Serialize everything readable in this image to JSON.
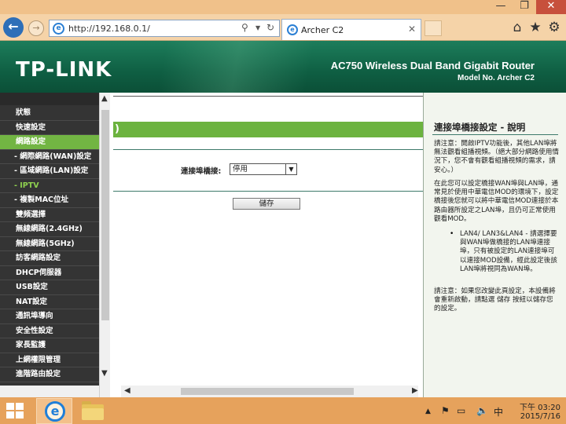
{
  "window": {
    "minimize_glyph": "—",
    "maximize_glyph": "❐",
    "close_glyph": "✕"
  },
  "browser": {
    "address": "http://192.168.0.1/",
    "tab_title": "Archer C2",
    "back_glyph": "←",
    "forward_glyph": "→",
    "search_glyph": "⚲",
    "dropdown_glyph": "▼",
    "refresh_glyph": "↻",
    "tab_close_glyph": "✕",
    "home_glyph": "⌂",
    "favorites_glyph": "★",
    "tools_glyph": "⚙",
    "page_icon_letter": "e"
  },
  "header": {
    "logo": "TP-LINK",
    "product": "AC750 Wireless Dual Band Gigabit Router",
    "model": "Model No. Archer C2"
  },
  "sidebar": {
    "items": [
      {
        "label": "狀態"
      },
      {
        "label": "快速設定"
      },
      {
        "label": "網路設定"
      },
      {
        "label": "- 網際網路(WAN)設定"
      },
      {
        "label": "- 區域網路(LAN)設定"
      },
      {
        "label": "- IPTV"
      },
      {
        "label": "- 複製MAC位址"
      },
      {
        "label": "雙頻選擇"
      },
      {
        "label": "無線網路(2.4GHz)"
      },
      {
        "label": "無線網路(5GHz)"
      },
      {
        "label": "訪客網路設定"
      },
      {
        "label": "DHCP伺服器"
      },
      {
        "label": "USB設定"
      },
      {
        "label": "NAT設定"
      },
      {
        "label": "通訊埠導向"
      },
      {
        "label": "安全性設定"
      },
      {
        "label": "家長監護"
      },
      {
        "label": "上網權限管理"
      },
      {
        "label": "進階路由設定"
      }
    ],
    "scroll_up_glyph": "▲",
    "scroll_down_glyph": "▼"
  },
  "main": {
    "section_title": ")",
    "iptv_label": "連接埠橋接:",
    "iptv_selected": "停用",
    "save_label": "儲存",
    "scroll_left_glyph": "◀",
    "scroll_right_glyph": "▶"
  },
  "help": {
    "title": "連接埠橋接設定 - 說明",
    "p1": "請注意：開啟IPTV功能後，其他LAN埠將無法觀看組播視頻。（絕大部分網路使用情況下，您不會有觀看組播視頻的需求，請安心。）",
    "p2": "在此您可以設定橋接WAN埠與LAN埠，通常見於使用中華電信MOD的環境下，設定橋接後您就可以將中華電信MOD連接於本路由器所設定之LAN埠，且仍可正常使用觀看MOD。",
    "bullet": "LAN4/ LAN3&LAN4 - 請選擇要與WAN埠做橋接的LAN埠連接埠，只有被設定的LAN連接埠可以連接MOD設備，經此設定後該LAN埠將視同為WAN埠。",
    "bullet_dot": "•",
    "p3": "請注意：如果您改變此頁設定，本設備將會重新啟動，請點選 儲存 按紐以儲存您的設定。"
  },
  "taskbar": {
    "ie_letter": "e",
    "tray_up_glyph": "▲",
    "tray_flag_glyph": "⚑",
    "tray_monitor_glyph": "▭",
    "tray_volume_glyph": "🔈",
    "ime": "中",
    "time": "下午 03:20",
    "date": "2015/7/16"
  },
  "colors": {
    "brand_green": "#0f5f43",
    "accent_green": "#6cb33f",
    "taskbar": "#e6a25c"
  }
}
